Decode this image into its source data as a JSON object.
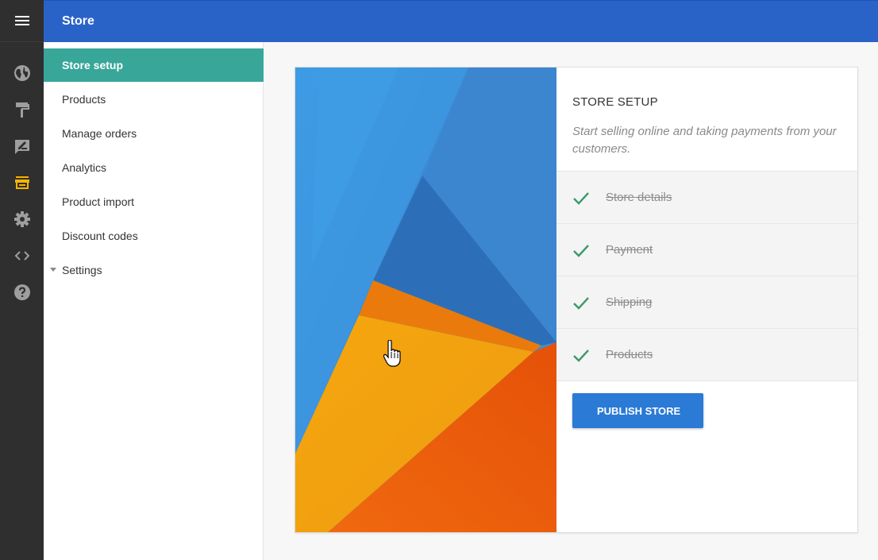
{
  "app": {
    "title": "Store"
  },
  "rail": {
    "menu_icon": "hamburger-menu-icon",
    "items": [
      {
        "icon": "globe-icon",
        "color": "#9e9e9e"
      },
      {
        "icon": "paint-roller-icon",
        "color": "#9e9e9e"
      },
      {
        "icon": "edit-note-icon",
        "color": "#9e9e9e"
      },
      {
        "icon": "store-icon",
        "color": "#f5b400",
        "active": true
      },
      {
        "icon": "gear-icon",
        "color": "#9e9e9e"
      },
      {
        "icon": "code-icon",
        "color": "#9e9e9e"
      },
      {
        "icon": "help-icon",
        "color": "#9e9e9e"
      }
    ]
  },
  "sidebar": {
    "items": [
      {
        "label": "Store setup",
        "active": true
      },
      {
        "label": "Products"
      },
      {
        "label": "Manage orders"
      },
      {
        "label": "Analytics"
      },
      {
        "label": "Product import"
      },
      {
        "label": "Discount codes"
      },
      {
        "label": "Settings",
        "expandable": true
      }
    ]
  },
  "card": {
    "heading": "STORE SETUP",
    "description": "Start selling online and taking payments from your customers.",
    "steps": [
      {
        "label": "Store details",
        "done": true
      },
      {
        "label": "Payment",
        "done": true
      },
      {
        "label": "Shipping",
        "done": true
      },
      {
        "label": "Products",
        "done": true
      }
    ],
    "publish_label": "PUBLISH STORE"
  },
  "colors": {
    "topbar": "#2a63c7",
    "active_nav": "#38a699",
    "check": "#3a9a6a",
    "button": "#2a7ad6",
    "active_rail_icon": "#f5b400"
  }
}
